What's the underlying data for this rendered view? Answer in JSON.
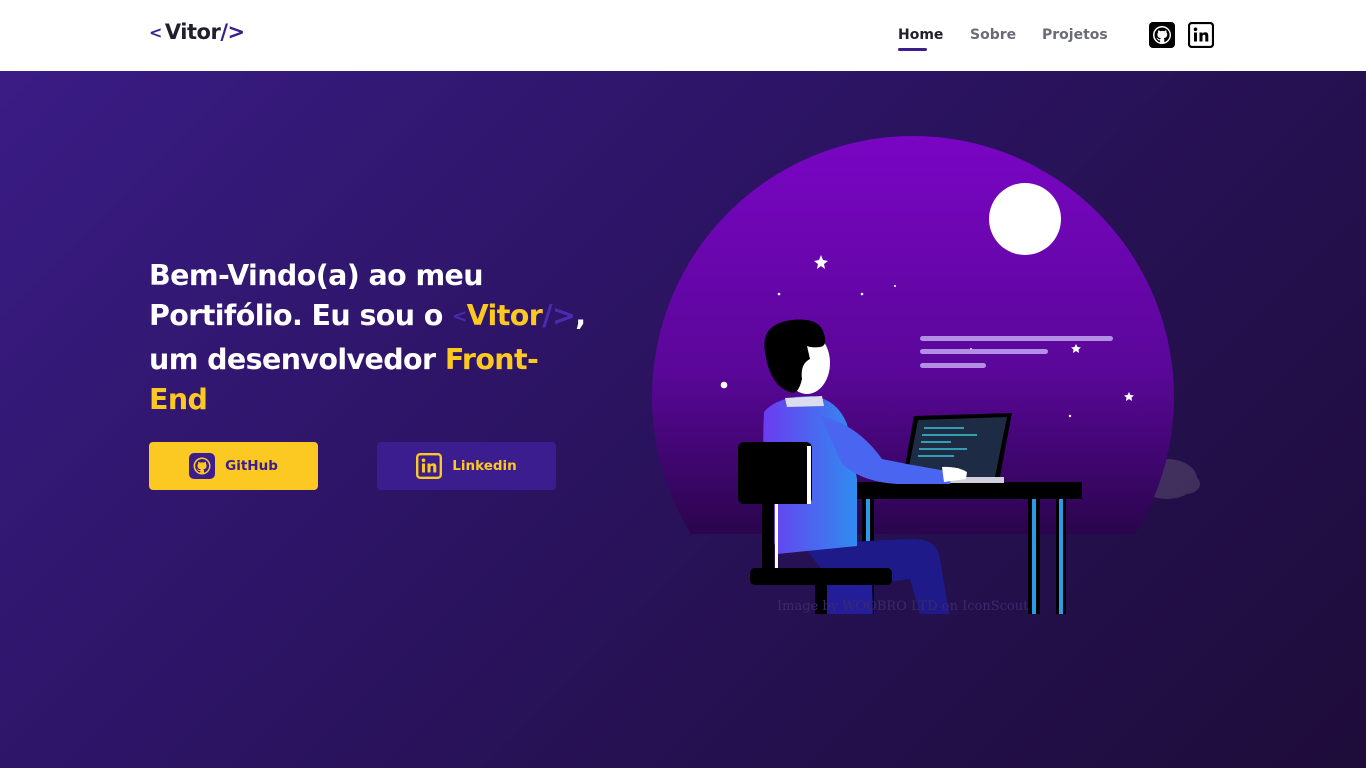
{
  "navbar": {
    "logo": {
      "open": "<",
      "name": "Vitor",
      "close": "/>"
    },
    "links": [
      {
        "label": "Home",
        "active": true
      },
      {
        "label": "Sobre",
        "active": false
      },
      {
        "label": "Projetos",
        "active": false
      }
    ],
    "icons": [
      "github-icon",
      "linkedin-icon"
    ]
  },
  "hero": {
    "line1": "Bem-Vindo(a) ao meu",
    "line2_prefix": "Portifólio. Eu sou o",
    "line2_open": "<",
    "line2_name": "Vitor",
    "line2_close": "/>",
    "line2_suffix": ",",
    "line3_prefix": "um desenvolvedor",
    "line3_highlight": "Front-",
    "line4_highlight": "End",
    "buttons": {
      "github": "GitHub",
      "linkedin": "Linkedin"
    },
    "image_credit": "Image by WOOBRO LTD on IconScout"
  },
  "colors": {
    "accent_yellow": "#fcc822",
    "accent_purple": "#3b1d8f",
    "hero_bg_start": "#3a1c85",
    "hero_bg_end": "#1e0c3a"
  }
}
